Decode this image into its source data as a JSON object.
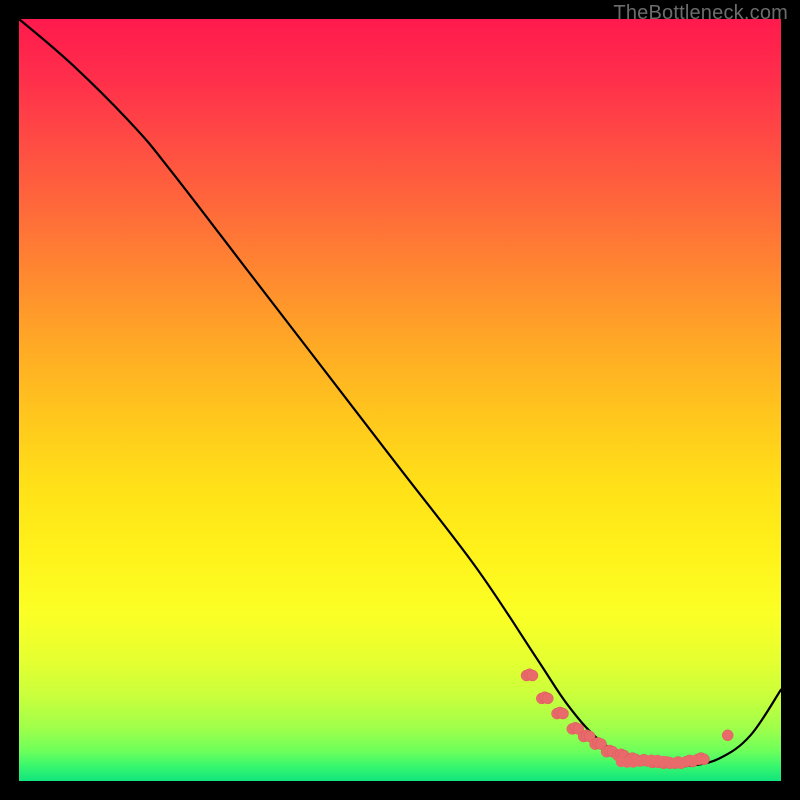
{
  "watermark": "TheBottleneck.com",
  "chart_data": {
    "type": "line",
    "title": "",
    "xlabel": "",
    "ylabel": "",
    "xlim": [
      0,
      100
    ],
    "ylim": [
      0,
      100
    ],
    "series": [
      {
        "name": "curve",
        "x": [
          0,
          7,
          15,
          20,
          30,
          40,
          50,
          60,
          68,
          72,
          76,
          80,
          84,
          88,
          92,
          96,
          100
        ],
        "values": [
          100,
          94,
          86,
          80,
          67,
          54,
          41,
          28,
          16,
          10,
          5.5,
          3,
          2,
          2,
          3,
          6,
          12
        ]
      }
    ],
    "markers": {
      "cluster": {
        "x": [
          67,
          69,
          71,
          73,
          74.5,
          76,
          77.5,
          79,
          80.5,
          82,
          83.5,
          85,
          86.5,
          88,
          89.5
        ],
        "values": [
          14,
          11,
          9,
          7,
          6,
          5,
          4,
          3.5,
          3,
          2.8,
          2.6,
          2.5,
          2.5,
          2.7,
          3
        ]
      },
      "outlier": {
        "x": 93,
        "value": 6
      }
    },
    "gradient_stops": [
      {
        "pos": 0,
        "color": "#ff1a4d"
      },
      {
        "pos": 50,
        "color": "#ffd81a"
      },
      {
        "pos": 90,
        "color": "#b4ff3a"
      },
      {
        "pos": 100,
        "color": "#11e57e"
      }
    ]
  }
}
